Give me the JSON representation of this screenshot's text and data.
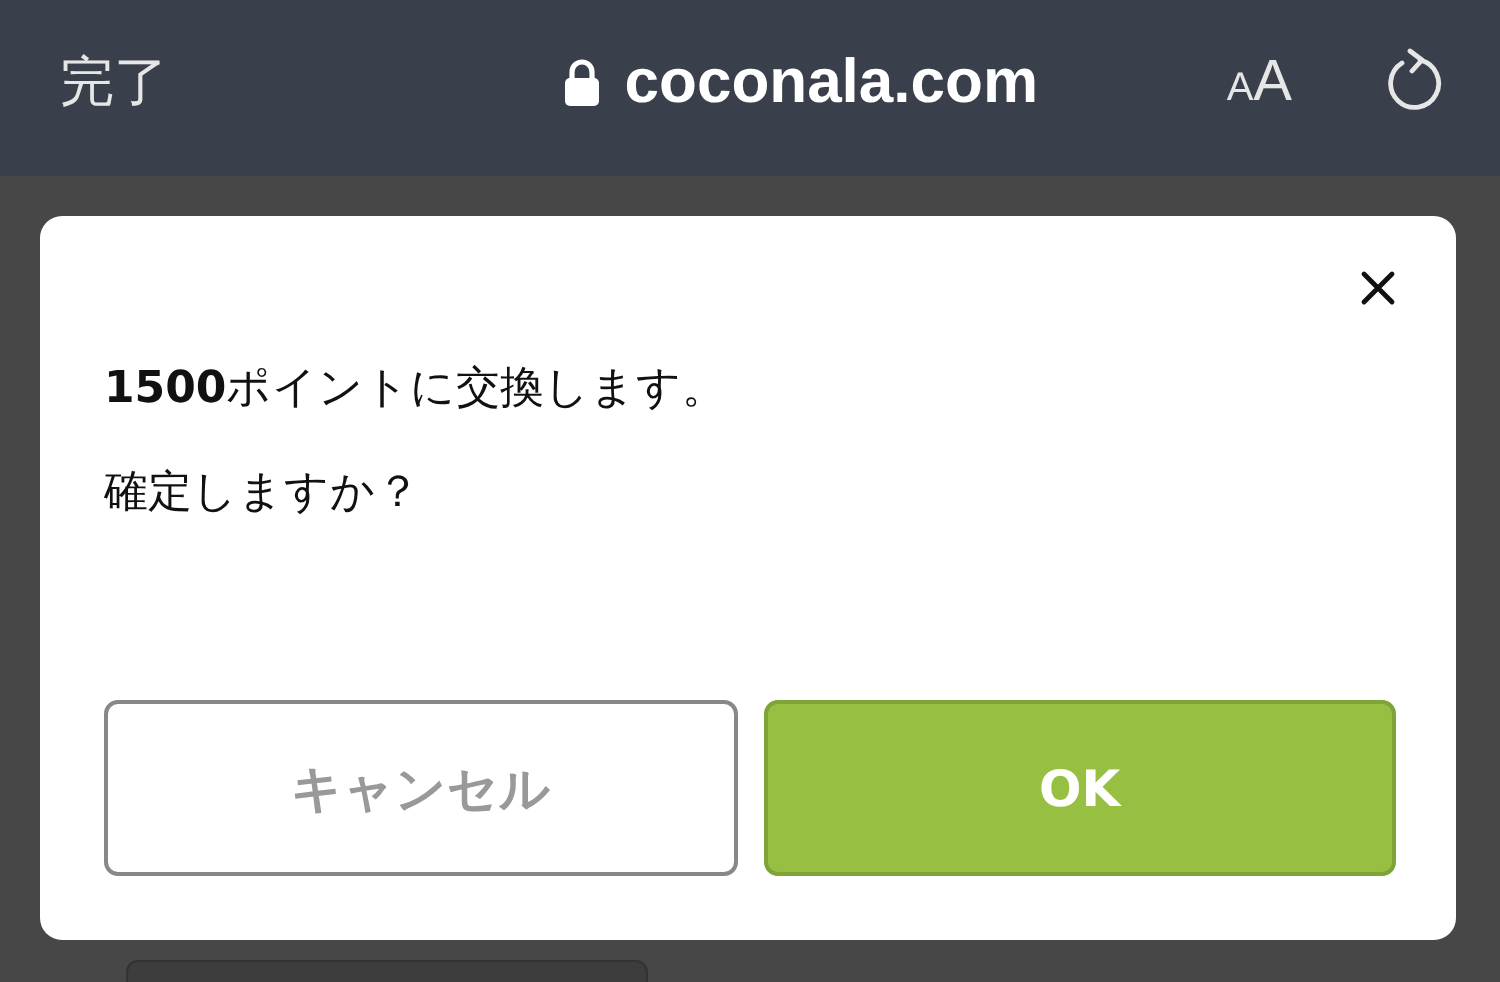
{
  "browser_bar": {
    "done": "完了",
    "address": "coconala.com",
    "text_size": "AA"
  },
  "dialog": {
    "message": [
      "**1500**ポイントに交換します。",
      "確定しますか？"
    ],
    "buttons": [
      {
        "label": "キャンセル",
        "kind": "secondary"
      },
      {
        "label": "OK",
        "kind": "primary"
      }
    ]
  }
}
